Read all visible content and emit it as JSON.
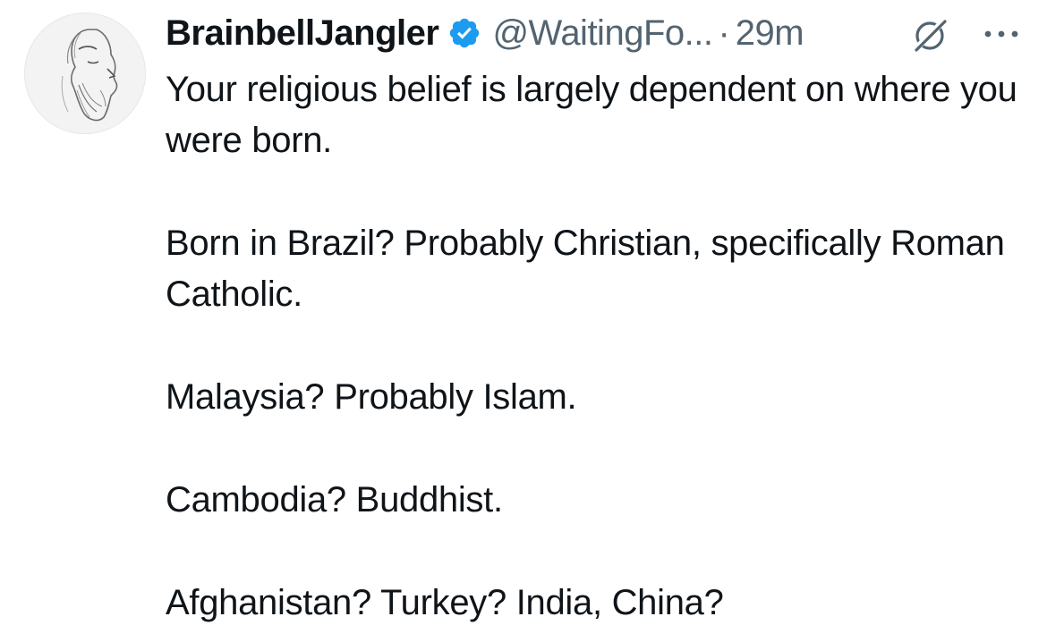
{
  "author": {
    "display_name": "BrainbellJangler",
    "handle": "@WaitingFo...",
    "separator": "·",
    "time": "29m",
    "verified": true,
    "verified_color": "#1d9bf0"
  },
  "icons": {
    "avatar": "sketch-portrait-avatar",
    "verified": "verified-badge-icon",
    "grok": "grok-slash-icon",
    "more": "more-ellipsis-icon"
  },
  "tweet": {
    "paragraphs": [
      "Your religious belief is largely dependent on where you were born.",
      "Born in Brazil? Probably Christian, specifically Roman Catholic.",
      "Malaysia? Probably Islam.",
      "Cambodia? Buddhist.",
      "Afghanistan? Turkey? India, China?"
    ]
  },
  "colors": {
    "text_primary": "#0f1419",
    "text_secondary": "#536471",
    "accent": "#1d9bf0"
  }
}
